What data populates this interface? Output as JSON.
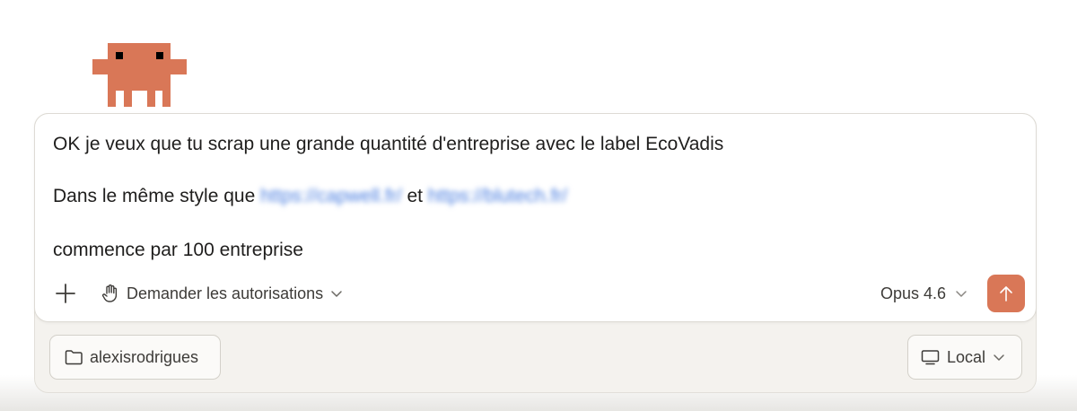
{
  "message": {
    "line1": "OK je veux que tu scrap une grande quantité d'entreprise avec le label EcoVadis",
    "line2_prefix": "Dans le même style que ",
    "link1": "https://capwell.fr/",
    "line2_middle": " et ",
    "link2": "https://blutech.fr/",
    "line3": "commence par 100 entreprise"
  },
  "toolbar": {
    "add_icon": "plus-icon",
    "permissions_label": "Demander les autorisations",
    "permissions_icon": "hand-icon",
    "model_label": "Opus 4.6",
    "send_icon": "arrow-up-icon"
  },
  "footer": {
    "folder_label": "alexisrodrigues",
    "folder_icon": "folder-icon",
    "environment_label": "Local",
    "environment_icon": "monitor-icon"
  },
  "colors": {
    "accent": "#d97757",
    "link": "#4a7ee0"
  }
}
